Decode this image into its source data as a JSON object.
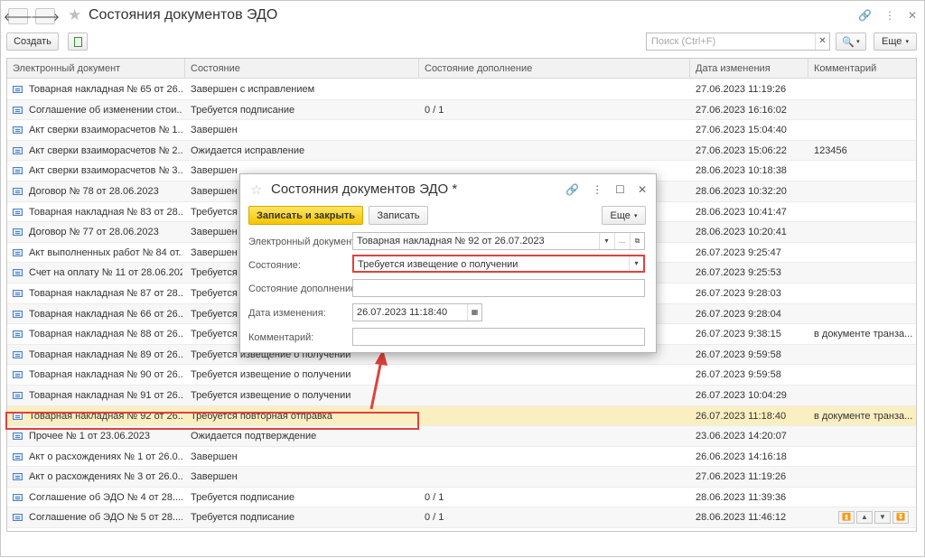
{
  "window": {
    "title": "Состояния документов ЭДО",
    "back_glyph": "🡐",
    "forward_glyph": "🡒"
  },
  "toolbar": {
    "create_label": "Создать",
    "search_placeholder": "Поиск (Ctrl+F)",
    "more_label": "Еще"
  },
  "table": {
    "columns": [
      "Электронный документ",
      "Состояние",
      "Состояние дополнение",
      "Дата изменения",
      "Комментарий"
    ],
    "rows": [
      [
        "Товарная накладная № 65 от 26....",
        "Завершен с исправлением",
        "",
        "27.06.2023 11:19:26",
        ""
      ],
      [
        "Соглашение об изменении стои...",
        "Требуется подписание",
        "0 / 1",
        "27.06.2023 16:16:02",
        ""
      ],
      [
        "Акт сверки взаиморасчетов № 1...",
        "Завершен",
        "",
        "27.06.2023 15:04:40",
        ""
      ],
      [
        "Акт сверки взаиморасчетов № 2...",
        "Ожидается исправление",
        "",
        "27.06.2023 15:06:22",
        "123456"
      ],
      [
        "Акт сверки взаиморасчетов № 3...",
        "Завершен",
        "",
        "28.06.2023 10:18:38",
        ""
      ],
      [
        "Договор № 78 от 28.06.2023",
        "Завершен",
        "",
        "28.06.2023 10:32:20",
        ""
      ],
      [
        "Товарная накладная № 83 от 28....",
        "Требуется у",
        "",
        "28.06.2023 10:41:47",
        ""
      ],
      [
        "Договор № 77 от 28.06.2023",
        "Завершен",
        "",
        "28.06.2023 10:20:41",
        ""
      ],
      [
        "Акт выполненных работ № 84 от...",
        "Завершен",
        "",
        "26.07.2023 9:25:47",
        ""
      ],
      [
        "Счет на оплату № 11 от 28.06.2023",
        "Требуется у",
        "",
        "26.07.2023 9:25:53",
        ""
      ],
      [
        "Товарная накладная № 87 от 28....",
        "Требуется у",
        "",
        "26.07.2023 9:28:03",
        ""
      ],
      [
        "Товарная накладная № 66 от 26....",
        "Требуется у",
        "",
        "26.07.2023 9:28:04",
        ""
      ],
      [
        "Товарная накладная № 88 от 26....",
        "Требуется п",
        "",
        "26.07.2023 9:38:15",
        "в документе транза..."
      ],
      [
        "Товарная накладная № 89 от 26....",
        "Требуется извещение о получении",
        "",
        "26.07.2023 9:59:58",
        ""
      ],
      [
        "Товарная накладная № 90 от 26....",
        "Требуется извещение о получении",
        "",
        "26.07.2023 9:59:58",
        ""
      ],
      [
        "Товарная накладная № 91 от 26....",
        "Требуется извещение о получении",
        "",
        "26.07.2023 10:04:29",
        ""
      ],
      [
        "Товарная накладная № 92 от 26....",
        "Требуется повторная отправка",
        "",
        "26.07.2023 11:18:40",
        "в документе транза..."
      ],
      [
        "Прочее № 1 от 23.06.2023",
        "Ожидается подтверждение",
        "",
        "23.06.2023 14:20:07",
        ""
      ],
      [
        "Акт о расхождениях № 1 от 26.0...",
        "Завершен",
        "",
        "26.06.2023 14:16:18",
        ""
      ],
      [
        "Акт о расхождениях № 3 от 26.0...",
        "Завершен",
        "",
        "27.06.2023 11:19:26",
        ""
      ],
      [
        "Соглашение об ЭДО № 4 от 28....",
        "Требуется подписание",
        "0 / 1",
        "28.06.2023 11:39:36",
        ""
      ],
      [
        "Соглашение об ЭДО № 5 от 28....",
        "Требуется подписание",
        "0 / 1",
        "28.06.2023 11:46:12",
        ""
      ]
    ],
    "selected_row": 16
  },
  "dialog": {
    "title": "Состояния документов ЭДО *",
    "save_close_label": "Записать и закрыть",
    "save_label": "Записать",
    "more_label": "Еще",
    "doc_label": "Электронный документ:",
    "doc_value": "Товарная накладная № 92 от 26.07.2023",
    "state_label": "Состояние:",
    "state_value": "Требуется извещение о получении",
    "state_extra_label": "Состояние дополнение:",
    "state_extra_value": "",
    "date_label": "Дата изменения:",
    "date_value": "26.07.2023 11:18:40",
    "comment_label": "Комментарий:",
    "comment_value": ""
  },
  "colors": {
    "accent_yellow": "#f4c500",
    "highlight_red": "#e0413d",
    "selected_row": "#fbefc1"
  }
}
